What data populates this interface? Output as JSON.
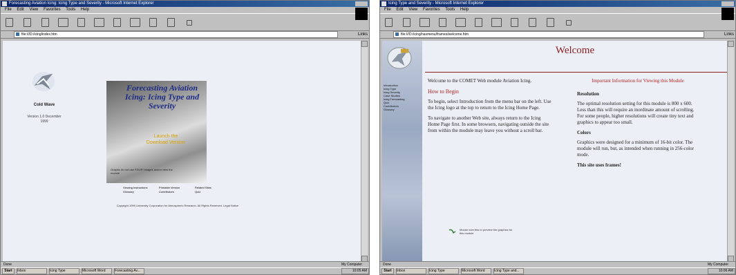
{
  "left_window": {
    "title": "Forecasting Aviation Icing: Icing Type and Severity - Microsoft Internet Explorer",
    "menu": [
      "File",
      "Edit",
      "View",
      "Favorites",
      "Tools",
      "Help"
    ],
    "address": "file:///D:/icing/index.htm",
    "go_label": "Links",
    "status": "Done",
    "zone": "My Computer",
    "logo_caption": "Cold Wave",
    "logo_sub": "Version 1.0 December 1999",
    "splash": {
      "title": "Forecasting Aviation Icing: Icing Type and Severity",
      "launch": "Launch the Download Version",
      "note": "Graphic do not use FSV/PI images and/or view the module"
    },
    "nav": [
      "Viewing Instructions",
      "Printable Version",
      "Related Sites",
      "Glossary",
      "Contributors",
      "Quiz"
    ],
    "copyright": "Copyright 1999 University Corporation for Atmospheric Research. All Rights Reserved. Legal Notice",
    "taskbar": {
      "start": "Start",
      "tasks": [
        "Inbox",
        "Icing Type",
        "Microsoft Word",
        "Forecasting Av..."
      ],
      "clock": "10:05 AM"
    }
  },
  "right_window": {
    "title": "Icing Type and Severity - Microsoft Internet Explorer",
    "menu": [
      "File",
      "Edit",
      "View",
      "Favorites",
      "Tools",
      "Help"
    ],
    "address": "file:///D:/icing/navmenu/frames/welcome.htm",
    "go_label": "Links",
    "status": "Done",
    "zone": "My Computer",
    "sidebar_links": [
      "Introduction",
      "Icing Type",
      "Icing Severity",
      "Case Studies",
      "Icing Forecasting",
      "Quiz",
      "Contributors",
      "Glossary"
    ],
    "page_title": "Welcome",
    "intro": "Welcome to the COMET Web module Aviation Icing.",
    "how_title": "How to Begin",
    "how_p1": "To begin, select Introduction from the menu bar on the left. Use the Icing logo at the top to return to the Icing Home Page.",
    "how_p2": "To navigate to another Web site, always return to the Icing Home Page first. In some browsers, navigating outside the site from within the module may leave you without a scroll bar.",
    "important": "Important Information for Viewing this Module",
    "res_title": "Resolution",
    "res_text": "The optimal resolution setting for this module is 800 x 600. Less than this will require an inordinate amount of scrolling. For some people, higher resolutions will create tiny text and graphics to appear too small.",
    "colors_title": "Colors",
    "colors_text": "Graphics were designed for a minimum of 16-bit color. The module will run, but, as intended when running in 256-color mode.",
    "features_title": "This site uses frames!",
    "foot_note": "Mouse over this to preview the graphics for this module",
    "taskbar": {
      "start": "Start",
      "tasks": [
        "Inbox",
        "Icing Type",
        "Microsoft Word",
        "Icing Type and..."
      ],
      "clock": "10:06 AM"
    }
  }
}
